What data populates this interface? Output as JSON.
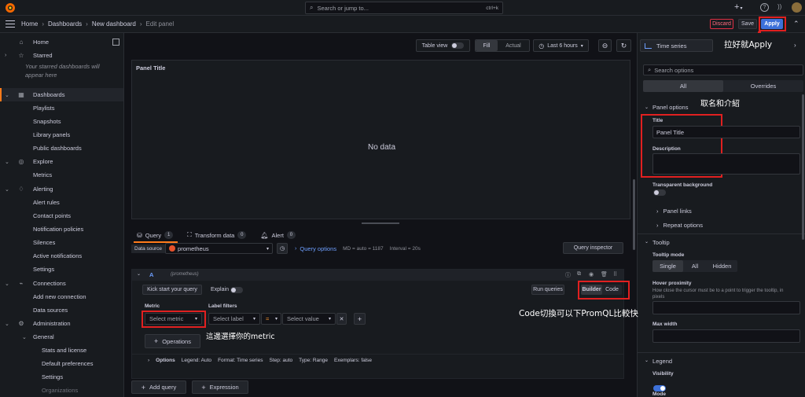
{
  "topbar": {
    "search_placeholder": "Search or jump to...",
    "search_shortcut": "ctrl+k",
    "plus_label": "+"
  },
  "breadcrumb": {
    "home": "Home",
    "dashboards": "Dashboards",
    "new_dashboard": "New dashboard",
    "current": "Edit panel"
  },
  "actions": {
    "discard": "Discard",
    "save": "Save",
    "apply": "Apply"
  },
  "sidebar": {
    "items": [
      {
        "label": "Home",
        "icon": "home-icon"
      },
      {
        "label": "Starred",
        "icon": "star-icon"
      },
      {
        "label": "Your starred dashboards will appear here"
      },
      {
        "label": "Dashboards",
        "icon": "dashboards-icon"
      },
      {
        "label": "Playlists"
      },
      {
        "label": "Snapshots"
      },
      {
        "label": "Library panels"
      },
      {
        "label": "Public dashboards"
      },
      {
        "label": "Explore",
        "icon": "compass-icon"
      },
      {
        "label": "Metrics"
      },
      {
        "label": "Alerting",
        "icon": "bell-icon"
      },
      {
        "label": "Alert rules"
      },
      {
        "label": "Contact points"
      },
      {
        "label": "Notification policies"
      },
      {
        "label": "Silences"
      },
      {
        "label": "Active notifications"
      },
      {
        "label": "Settings"
      },
      {
        "label": "Connections",
        "icon": "connections-icon"
      },
      {
        "label": "Add new connection"
      },
      {
        "label": "Data sources"
      },
      {
        "label": "Administration",
        "icon": "gear-icon"
      },
      {
        "label": "General"
      },
      {
        "label": "Stats and license"
      },
      {
        "label": "Default preferences"
      },
      {
        "label": "Settings"
      },
      {
        "label": "Organizations"
      }
    ]
  },
  "toolbar": {
    "table_view": "Table view",
    "fill": "Fill",
    "actual": "Actual",
    "time_range": "Last 6 hours"
  },
  "panel": {
    "title": "Panel Title",
    "no_data": "No data"
  },
  "query_tabs": {
    "query": "Query",
    "query_count": "1",
    "transform": "Transform data",
    "transform_count": "0",
    "alert": "Alert",
    "alert_count": "0"
  },
  "query_options": {
    "data_source_label": "Data source",
    "data_source_value": "prometheus",
    "query_options_label": "Query options",
    "md_info": "MD = auto = 1187",
    "interval_info": "Interval = 20s",
    "query_inspector": "Query inspector"
  },
  "query_row": {
    "ref_id": "A",
    "ds_name": "(prometheus)",
    "kick_start": "Kick start your query",
    "explain": "Explain",
    "run_queries": "Run queries",
    "builder": "Builder",
    "code": "Code",
    "metric_label": "Metric",
    "label_filters_label": "Label filters",
    "select_metric": "Select metric",
    "select_label": "Select label",
    "operator": "=",
    "select_value": "Select value",
    "operations": "Operations",
    "options": "Options",
    "legend": "Legend: Auto",
    "format": "Format: Time series",
    "step": "Step: auto",
    "type": "Type: Range",
    "exemplars": "Exemplars: false"
  },
  "bottom_buttons": {
    "add_query": "Add query",
    "expression": "Expression"
  },
  "options_pane": {
    "viz_type": "Time series",
    "search_placeholder": "Search options",
    "tab_all": "All",
    "tab_overrides": "Overrides",
    "panel_options": "Panel options",
    "title_label": "Title",
    "title_value": "Panel Title",
    "description_label": "Description",
    "transparent_bg": "Transparent background",
    "panel_links": "Panel links",
    "repeat_options": "Repeat options",
    "tooltip": "Tooltip",
    "tooltip_mode": "Tooltip mode",
    "mode_single": "Single",
    "mode_all": "All",
    "mode_hidden": "Hidden",
    "hover_proximity": "Hover proximity",
    "hover_desc": "How close the cursor must be to a point to trigger the tooltip, in pixels",
    "max_width": "Max width",
    "legend": "Legend",
    "visibility": "Visibility",
    "mode": "Mode"
  },
  "annotations": {
    "apply_note": "拉好就Apply",
    "title_note": "取名和介紹",
    "code_note": "Code切換可以下PromQL比較快",
    "metric_note": "這邊選擇你的metric"
  },
  "colors": {
    "accent": "#3d71d9",
    "discard": "#e02f44",
    "annotation": "#e02020",
    "active_bar": "#ff7a1a"
  }
}
